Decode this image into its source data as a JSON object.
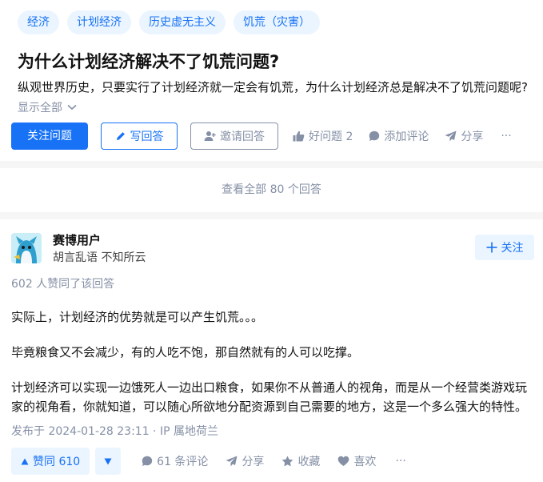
{
  "question": {
    "topics": [
      "经济",
      "计划经济",
      "历史虚无主义",
      "饥荒（灾害）"
    ],
    "title": "为什么计划经济解决不了饥荒问题?",
    "description": "纵观世界历史，只要实行了计划经济就一定会有饥荒，为什么计划经济总是解决不了饥荒问题呢?",
    "show_all": "显示全部",
    "actions": {
      "follow": "关注问题",
      "write_answer": "写回答",
      "invite": "邀请回答",
      "good_question": "好问题 2",
      "add_comment": "添加评论",
      "share": "分享",
      "more": "···"
    }
  },
  "view_all_answers": "查看全部 80 个回答",
  "answer": {
    "author": {
      "name": "赛博用户",
      "bio": "胡言乱语 不知所云",
      "follow_label": "关注"
    },
    "vote_summary": "602 人赞同了该回答",
    "paragraphs": [
      "实际上，计划经济的优势就是可以产生饥荒。。。",
      "毕竟粮食又不会减少，有的人吃不饱，那自然就有的人可以吃撑。",
      "计划经济可以实现一边饿死人一边出口粮食，如果你不从普通人的视角，而是从一个经营类游戏玩",
      "家的视角看，你就知道，可以随心所欲地分配资源到自己需要的地方，这是一个多么强大的特性。"
    ],
    "published": "发布于 2024-01-28 23:11 · IP 属地荷兰",
    "actions": {
      "upvote": "赞同 610",
      "comments": "61 条评论",
      "share": "分享",
      "favorite": "收藏",
      "like": "喜欢",
      "more": "···"
    }
  },
  "colors": {
    "accent": "#1772f6",
    "accent_bg": "#ebf5ff",
    "muted": "#8590a6",
    "page_bg": "#f6f6f6"
  }
}
